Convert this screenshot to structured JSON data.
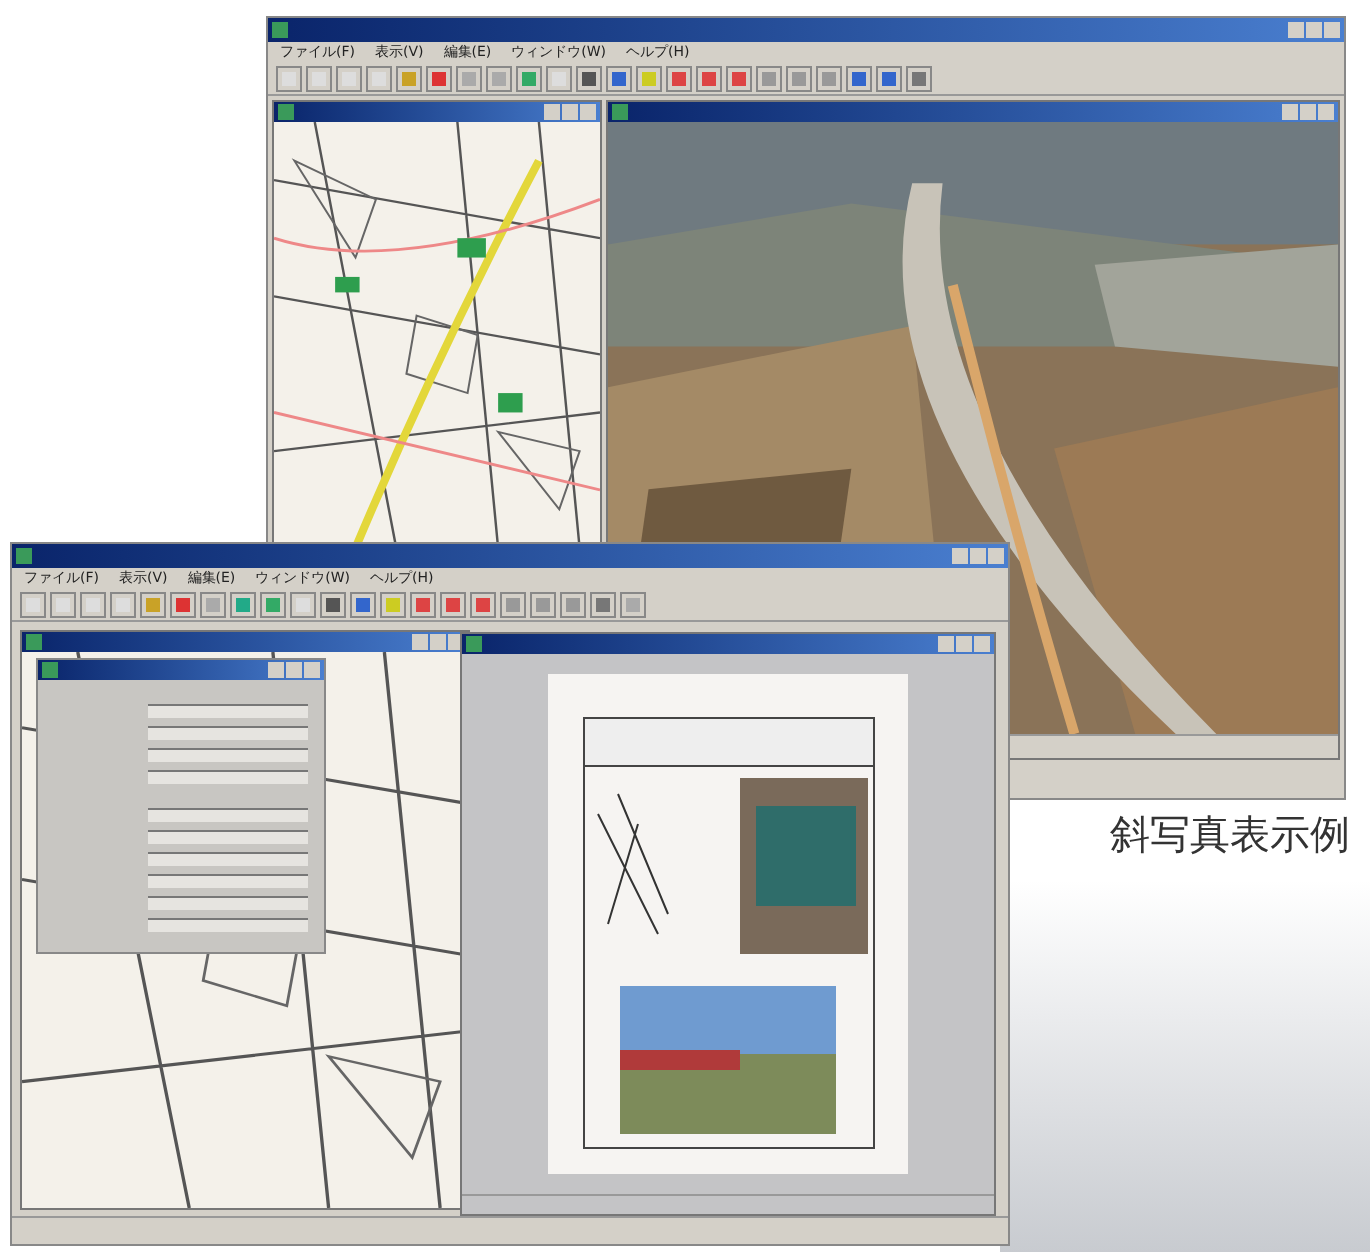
{
  "windows": [
    {
      "menu": [
        "ファイル(F)",
        "表示(V)",
        "編集(E)",
        "ウィンドウ(W)",
        "ヘルプ(H)"
      ]
    },
    {
      "menu": [
        "ファイル(F)",
        "表示(V)",
        "編集(E)",
        "ウィンドウ(W)",
        "ヘルプ(H)"
      ]
    }
  ],
  "caption": "斜写真表示例"
}
